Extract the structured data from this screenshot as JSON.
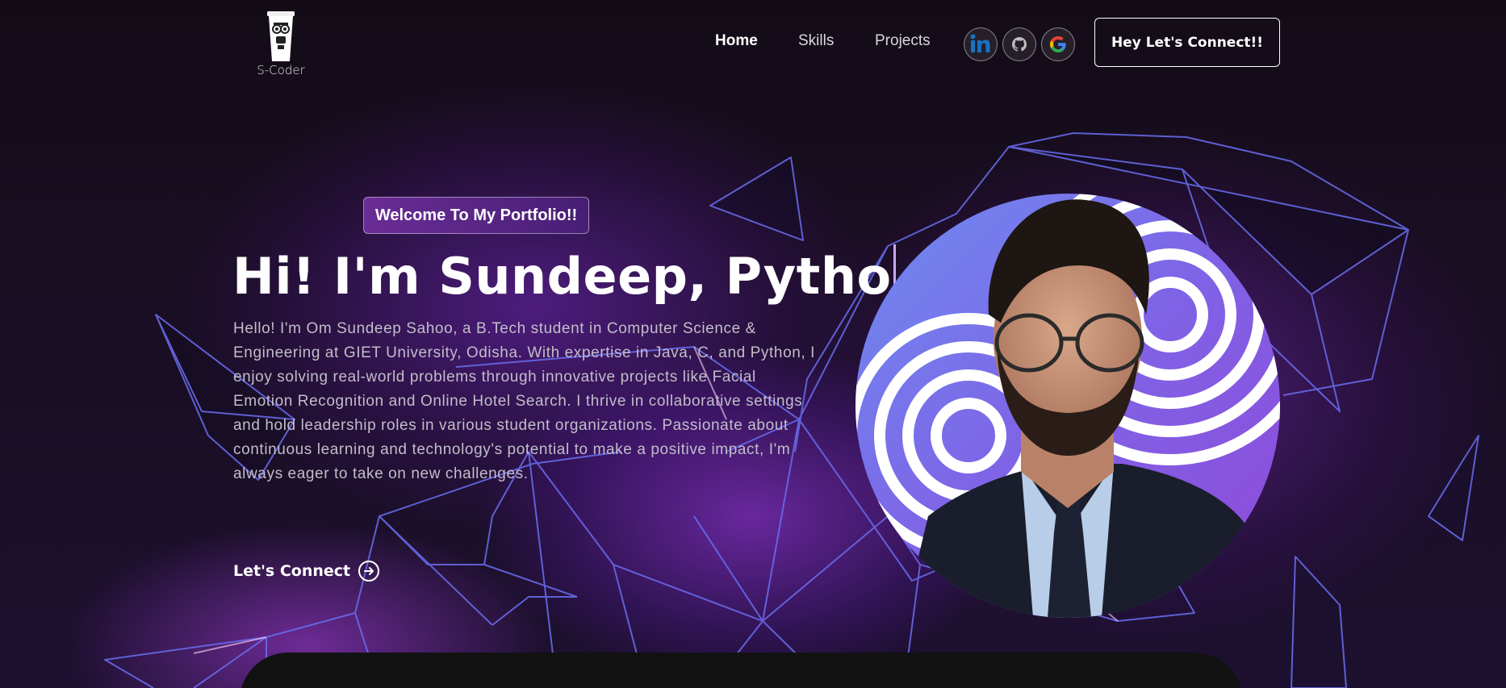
{
  "nav": {
    "logo_text": "S-Coder",
    "links": [
      {
        "label": "Home",
        "active": true
      },
      {
        "label": "Skills",
        "active": false
      },
      {
        "label": "Projects",
        "active": false
      }
    ],
    "socials": [
      {
        "icon": "linkedin-icon"
      },
      {
        "icon": "github-icon"
      },
      {
        "icon": "google-icon"
      }
    ],
    "cta_label": "Hey Let's Connect!!"
  },
  "hero": {
    "tagline": "Welcome To My Portfolio!!",
    "headline": "Hi! I'm Sundeep, Pytho",
    "intro": "Hello! I'm Om Sundeep Sahoo, a B.Tech student in Computer Science & Engineering at GIET University, Odisha. With expertise in Java, C, and Python, I enjoy solving real-world problems through innovative projects like Facial Emotion Recognition and Online Hotel Search. I thrive in collaborative settings and hold leadership roles in various student organizations. Passionate about continuous learning and technology's potential to make a positive impact, I'm always eager to take on new challenges.",
    "connect_label": "Let's Connect"
  },
  "colors": {
    "accent": "#8b3dff",
    "tagline_bg": "#6a2fa0",
    "line": "#6f6fe8"
  }
}
